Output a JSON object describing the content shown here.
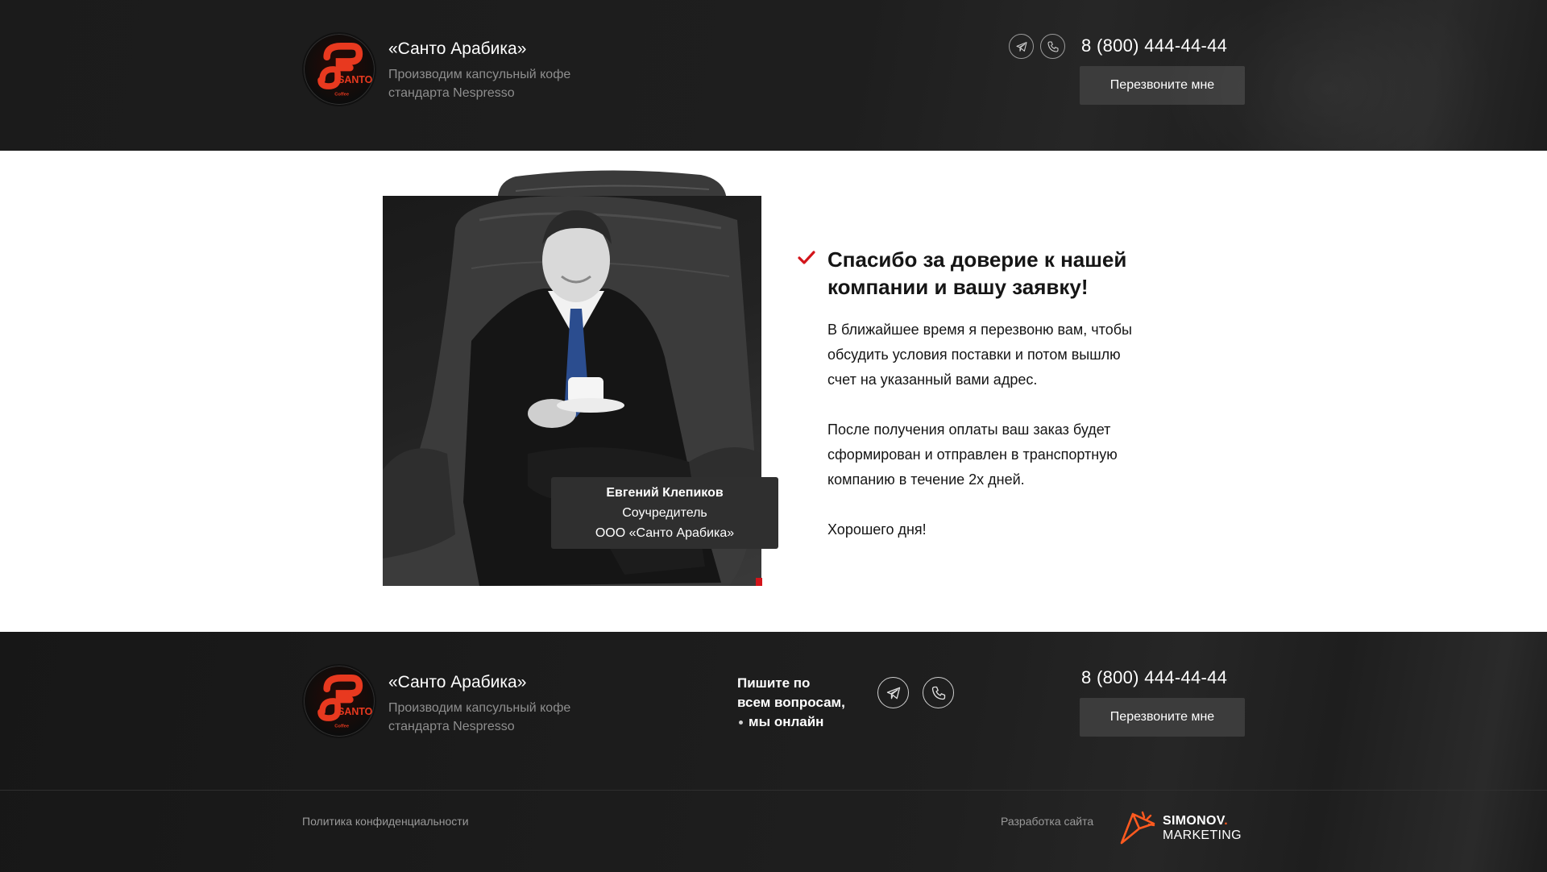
{
  "header": {
    "brand_name": "«Санто Арабика»",
    "brand_desc_line1": "Производим капсульный кофе",
    "brand_desc_line2": "стандарта Nespresso",
    "phone": "8 (800) 444-44-44",
    "callback_label": "Перезвоните мне",
    "logo_text": "SANTO",
    "logo_sub": "Coffee"
  },
  "main": {
    "caption": {
      "name": "Евгений Клепиков",
      "role": "Соучредитель",
      "company": "ООО «Санто Арабика»"
    },
    "title_line1": "Спасибо за доверие к нашей",
    "title_line2": "компании и вашу заявку!",
    "para1": [
      "В ближайшее время я перезвоню вам, чтобы",
      "обсудить условия поставки и потом вышлю",
      "счет на указанный вами адрес."
    ],
    "para2": [
      "После получения оплаты ваш заказ будет",
      "сформирован и отправлен в транспортную",
      "компанию в течение 2х дней."
    ],
    "closing": "Хорошего дня!"
  },
  "footer": {
    "brand_name": "«Санто Арабика»",
    "brand_desc_line1": "Производим капсульный кофе",
    "brand_desc_line2": "стандарта Nespresso",
    "write_us_line1": "Пишите по",
    "write_us_line2": "всем вопросам,",
    "write_us_line3": "мы онлайн",
    "phone": "8 (800) 444-44-44",
    "callback_label": "Перезвоните мне",
    "privacy": "Политика конфиденциальности",
    "dev_label": "Разработка сайта",
    "dev_logo_top": "SIMONOV",
    "dev_logo_dot": ".",
    "dev_logo_bottom": "MARKETING"
  },
  "colors": {
    "accent_red": "#d3141a",
    "dev_orange": "#ff5a1f"
  },
  "icons": [
    "telegram-icon",
    "phone-icon",
    "check-icon",
    "paper-plane-icon"
  ]
}
